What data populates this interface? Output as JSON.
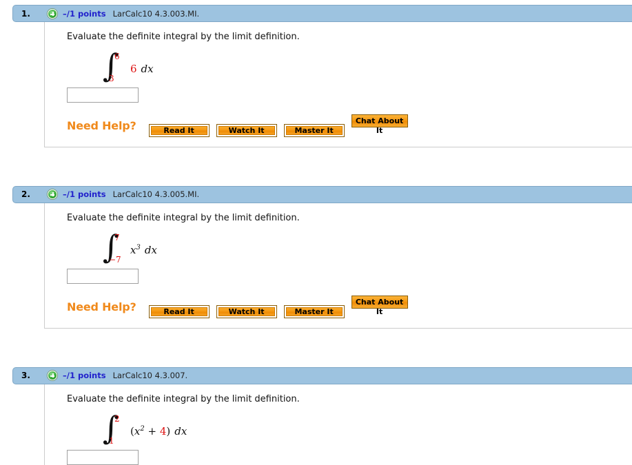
{
  "help": {
    "label": "Need Help?",
    "buttons": [
      {
        "label": "Read It",
        "style": "framed"
      },
      {
        "label": "Watch It",
        "style": "framed"
      },
      {
        "label": "Master It",
        "style": "framed"
      },
      {
        "label": "Chat About It",
        "style": "plain"
      }
    ]
  },
  "icons": {
    "expand": "plus-circle-icon"
  },
  "colors": {
    "header_blue": "#9dc3e0",
    "header_border": "#7fa7c6",
    "points_blue": "#2222cc",
    "need_help_orange": "#f08a1c",
    "math_red": "#dd1111",
    "button_orange": "#f59a14"
  },
  "questions": [
    {
      "number": "1.",
      "points": "–/1 points",
      "code": "LarCalc10 4.3.003.MI.",
      "prompt": "Evaluate the definite integral by the limit definition.",
      "integral": {
        "upper": "6",
        "lower": "3",
        "integrand_html": "<span class=\"red\">6</span><span class=\"dx\">dx</span>",
        "integrand_text": "6 dx"
      },
      "answer_value": "",
      "truncated": false
    },
    {
      "number": "2.",
      "points": "–/1 points",
      "code": "LarCalc10 4.3.005.MI.",
      "prompt": "Evaluate the definite integral by the limit definition.",
      "integral": {
        "upper": "7",
        "lower": "−7",
        "integrand_html": "<span class=\"var\">x</span><sup>3</sup><span class=\"dx\">dx</span>",
        "integrand_text": "x^3 dx"
      },
      "answer_value": "",
      "truncated": false
    },
    {
      "number": "3.",
      "points": "–/1 points",
      "code": "LarCalc10 4.3.007.",
      "prompt": "Evaluate the definite integral by the limit definition.",
      "integral": {
        "upper": "2",
        "lower": "1",
        "integrand_html": "<span class=\"op\">(</span><span class=\"var\">x</span><sup>2</sup><span class=\"op\">&nbsp;+&nbsp;</span><span class=\"red\">4</span><span class=\"op\">)</span><span class=\"dx\">dx</span>",
        "integrand_text": "(x^2 + 4) dx"
      },
      "answer_value": "",
      "truncated": true
    }
  ]
}
